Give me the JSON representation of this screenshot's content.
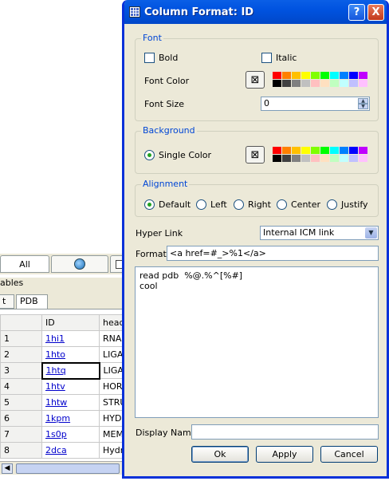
{
  "background_window": {
    "tabs": [
      {
        "label": "All"
      },
      {
        "icon": "globe-icon"
      },
      {
        "icon": "table-icon"
      }
    ],
    "section_label": "ables",
    "subtabs": [
      "t",
      "PDB"
    ],
    "columns": [
      "ID",
      "head"
    ],
    "rows": [
      {
        "n": "1",
        "id": "1hi1",
        "head": "RNA"
      },
      {
        "n": "2",
        "id": "1hto",
        "head": "LIGAS"
      },
      {
        "n": "3",
        "id": "1htq",
        "head": "LIGAS"
      },
      {
        "n": "4",
        "id": "1htv",
        "head": "HORM"
      },
      {
        "n": "5",
        "id": "1htw",
        "head": "STRU"
      },
      {
        "n": "6",
        "id": "1kpm",
        "head": "HYDF"
      },
      {
        "n": "7",
        "id": "1s0p",
        "head": "MEME"
      },
      {
        "n": "8",
        "id": "2dca",
        "head": "Hydro"
      }
    ]
  },
  "dialog": {
    "title": "Column Format: ID",
    "help_button": "?",
    "close_button": "X",
    "font_group": {
      "title": "Font",
      "bold_label": "Bold",
      "italic_label": "Italic",
      "font_color_label": "Font Color",
      "font_size_label": "Font Size",
      "font_size_value": "0"
    },
    "background_group": {
      "title": "Background",
      "single_color_label": "Single Color"
    },
    "alignment_group": {
      "title": "Alignment",
      "options": [
        "Default",
        "Left",
        "Right",
        "Center",
        "Justify"
      ],
      "selected": "Default"
    },
    "hyper_link_label": "Hyper Link",
    "hyper_link_value": "Internal ICM link",
    "format_label": "Format",
    "format_value": "<a href=#_>%1</a>",
    "script_text": "read pdb  %@.%^[%#]\ncool",
    "display_name_label": "Display Name",
    "display_name_value": "",
    "ok_label": "Ok",
    "apply_label": "Apply",
    "cancel_label": "Cancel",
    "palette_colors": [
      "#ff0000",
      "#ff8000",
      "#ffc000",
      "#ffff00",
      "#80ff00",
      "#00ff00",
      "#00ffff",
      "#0080ff",
      "#0000ff",
      "#c000ff",
      "#000000",
      "#404040",
      "#808080",
      "#c0c0c0",
      "#ffc0c0",
      "#ffe0c0",
      "#c0ffc0",
      "#c0ffff",
      "#c0c0ff",
      "#ffc0ff"
    ]
  }
}
